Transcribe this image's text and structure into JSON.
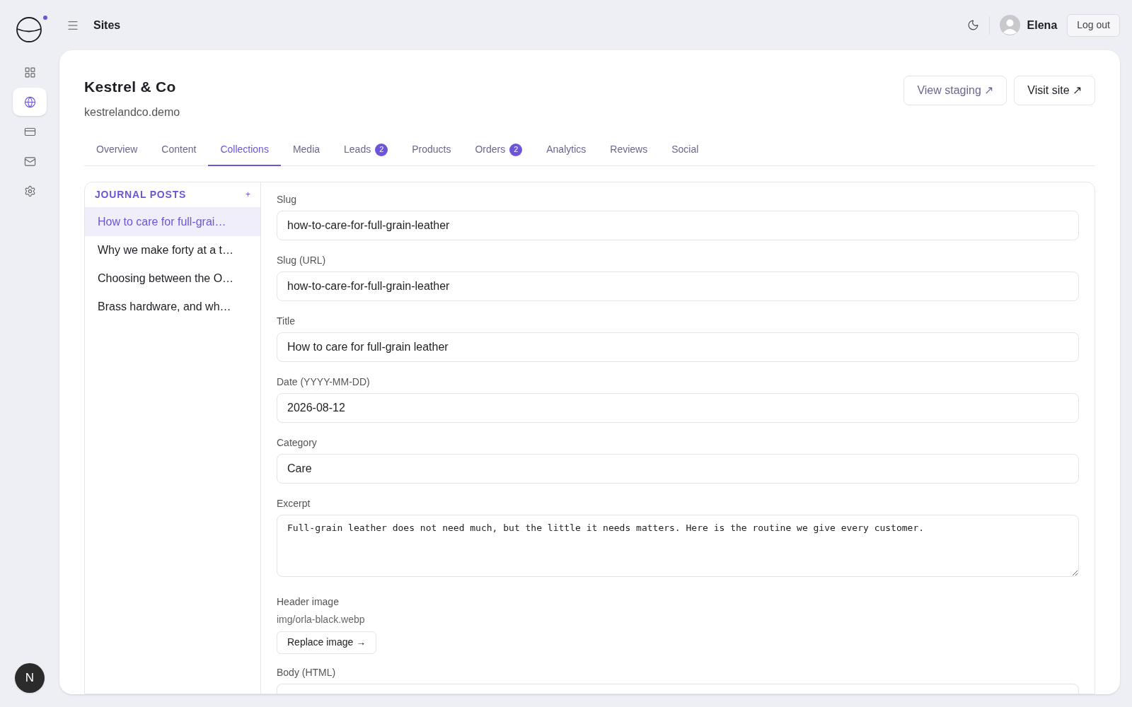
{
  "topbar": {
    "title": "Sites",
    "user": "Elena",
    "logout": "Log out"
  },
  "rail": [
    {
      "selected": false
    },
    {
      "selected": true
    },
    {
      "selected": false
    },
    {
      "selected": false
    },
    {
      "selected": false
    }
  ],
  "rail_badge": "N",
  "site": {
    "name": "Kestrel & Co",
    "domain": "kestrelandco.demo",
    "buttons": [
      {
        "label": "View staging ↗",
        "kind": "muted"
      },
      {
        "label": "Visit site ↗",
        "kind": "dark"
      }
    ]
  },
  "tabs": [
    {
      "label": "Overview",
      "selected": false
    },
    {
      "label": "Content",
      "selected": false
    },
    {
      "label": "Collections",
      "selected": true
    },
    {
      "label": "Media",
      "selected": false
    },
    {
      "label": "Leads",
      "badge": "2",
      "selected": false
    },
    {
      "label": "Products",
      "selected": false
    },
    {
      "label": "Orders",
      "badge": "2",
      "selected": false
    },
    {
      "label": "Analytics",
      "selected": false
    },
    {
      "label": "Reviews",
      "selected": false
    },
    {
      "label": "Social",
      "selected": false
    }
  ],
  "collection": {
    "title": "JOURNAL POSTS",
    "add": "+",
    "items": [
      {
        "label": "How to care for full-grai…",
        "selected": true
      },
      {
        "label": "Why we make forty at a t…",
        "selected": false
      },
      {
        "label": "Choosing between the O…",
        "selected": false
      },
      {
        "label": "Brass hardware, and wh…",
        "selected": false
      }
    ]
  },
  "fields": [
    {
      "kind": "input",
      "label": "Slug",
      "value": "how-to-care-for-full-grain-leather"
    },
    {
      "kind": "input",
      "label": "Slug (URL)",
      "value": "how-to-care-for-full-grain-leather"
    },
    {
      "kind": "input",
      "label": "Title",
      "value": "How to care for full-grain leather"
    },
    {
      "kind": "input",
      "label": "Date (YYYY-MM-DD)",
      "value": "2026-08-12"
    },
    {
      "kind": "input",
      "label": "Category",
      "value": "Care"
    },
    {
      "kind": "textarea",
      "label": "Excerpt",
      "value": "Full-grain leather does not need much, but the little it needs matters. Here is the routine we give every customer."
    },
    {
      "kind": "image",
      "label": "Header image",
      "path": "img/orla-black.webp",
      "button": "Replace image →"
    },
    {
      "kind": "input",
      "label": "Body (HTML)"
    }
  ]
}
